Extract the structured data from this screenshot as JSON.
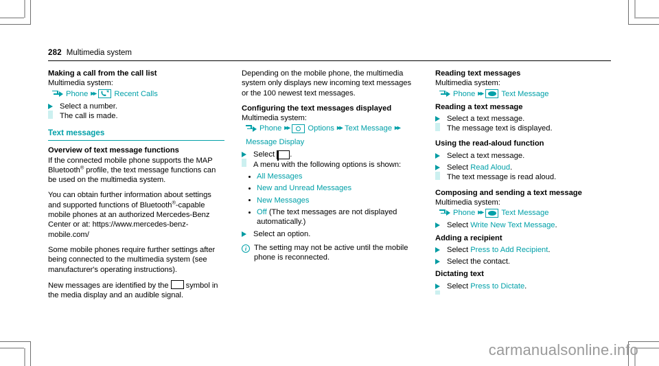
{
  "header": {
    "folio": "282",
    "chapter": "Multimedia system"
  },
  "colors": {
    "accent": "#00a0a8",
    "step_marker": "#009ba2",
    "step_bar": "#ccf0f0",
    "watermark": "#9a9a9a"
  },
  "col1": {
    "h3_call": "Making a call from the call list",
    "intro_call": "Multimedia system:",
    "path_phone": "Phone",
    "path_recent_calls": "Recent Calls",
    "step_select_number": "Select a number.",
    "result_call_made": "The call is made.",
    "section_title": "Text messages",
    "h3_overview": "Overview of text message functions",
    "p1_a": "If the connected mobile phone supports the MAP Bluetooth",
    "p1_sup": "®",
    "p1_b": " profile, the text message functions can be used on the multimedia system.",
    "p2_a": "You can obtain further information about settings and supported functions of Bluetooth",
    "p2_sup": "®",
    "p2_b": "-capable mobile phones at an authorized Mercedes-Benz Center or at: https://www.mercedes-benz-mobile.com/",
    "p3": "Some mobile phones require further settings after being connected to the multimedia system (see manufacturer's operating instructions).",
    "p4_a": "New messages are identified by the",
    "p4_b": "symbol in the media display and an audible signal."
  },
  "col2": {
    "p1": "Depending on the mobile phone, the multimedia system only displays new incoming text messages or the 100 newest text messages.",
    "h3_configuring": "Configuring the text messages displayed",
    "intro": "Multimedia system:",
    "path_phone": "Phone",
    "path_options": "Options",
    "path_text_message": "Text Message",
    "path_message_display": "Message Display",
    "step_select": "Select",
    "step_select_end": ".",
    "result_menu": "A menu with the following options is shown:",
    "options": [
      {
        "label": "All Messages",
        "note": ""
      },
      {
        "label": "New and Unread Messages",
        "note": ""
      },
      {
        "label": "New Messages",
        "note": ""
      },
      {
        "label": "Off",
        "note": "(The text messages are not displayed automatically.)"
      }
    ],
    "step_select_option": "Select an option.",
    "note": "The setting may not be active until the mobile phone is reconnected."
  },
  "col3": {
    "h3_reading": "Reading text messages",
    "intro_reading": "Multimedia system:",
    "path_phone": "Phone",
    "path_text_message": "Text Message",
    "h3_read_one": "Reading a text message",
    "step_select_msg": "Select a text message.",
    "result_displayed": "The message text is displayed.",
    "h3_read_aloud": "Using the read-aloud function",
    "step_select_msg2": "Select a text message.",
    "step_select_label": "Select",
    "step_read_aloud_link": "Read Aloud",
    "step_period": ".",
    "result_read_aloud": "The text message is read aloud.",
    "h3_composing": "Composing and sending a text message",
    "intro_composing": "Multimedia system:",
    "path_phone2": "Phone",
    "path_text_message2": "Text Message",
    "step_write_label": "Select",
    "step_write_link": "Write New Text Message",
    "h3_recipient": "Adding a recipient",
    "step_add_label": "Select",
    "step_add_link": "Press to Add Recipient",
    "step_select_contact": "Select the contact.",
    "h3_dictating": "Dictating text",
    "step_dictate_label": "Select",
    "step_dictate_link": "Press to Dictate"
  },
  "watermark": "carmanualsonline.info"
}
